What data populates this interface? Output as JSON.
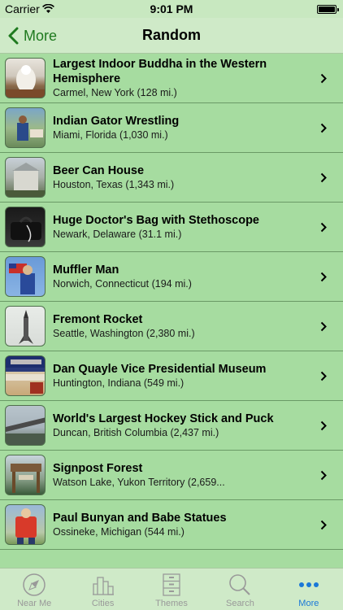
{
  "status": {
    "carrier": "Carrier",
    "time": "9:01 PM"
  },
  "nav": {
    "back_label": "More",
    "title": "Random"
  },
  "items": [
    {
      "name": "Largest Indoor Buddha in the Western Hemisphere",
      "location": "Carmel, New York (128 mi.)"
    },
    {
      "name": "Indian Gator Wrestling",
      "location": "Miami, Florida (1,030 mi.)"
    },
    {
      "name": "Beer Can House",
      "location": "Houston, Texas (1,343 mi.)"
    },
    {
      "name": "Huge Doctor's Bag with Stethoscope",
      "location": "Newark, Delaware (31.1 mi.)"
    },
    {
      "name": "Muffler Man",
      "location": "Norwich, Connecticut (194 mi.)"
    },
    {
      "name": "Fremont Rocket",
      "location": "Seattle, Washington (2,380 mi.)"
    },
    {
      "name": "Dan Quayle Vice Presidential Museum",
      "location": "Huntington, Indiana (549 mi.)"
    },
    {
      "name": "World's Largest Hockey Stick and Puck",
      "location": "Duncan, British Columbia (2,437 mi.)"
    },
    {
      "name": "Signpost Forest",
      "location": "Watson Lake, Yukon Territory (2,659..."
    },
    {
      "name": "Paul Bunyan and Babe Statues",
      "location": "Ossineke, Michigan (544 mi.)"
    }
  ],
  "tabs": [
    {
      "label": "Near Me",
      "icon": "compass-icon"
    },
    {
      "label": "Cities",
      "icon": "city-icon"
    },
    {
      "label": "Themes",
      "icon": "cabinet-icon"
    },
    {
      "label": "Search",
      "icon": "search-icon"
    },
    {
      "label": "More",
      "icon": "more-icon"
    }
  ],
  "colors": {
    "accent": "#1f7a1f",
    "tab_active": "#1a78d8",
    "list_bg": "#a6dca0"
  }
}
